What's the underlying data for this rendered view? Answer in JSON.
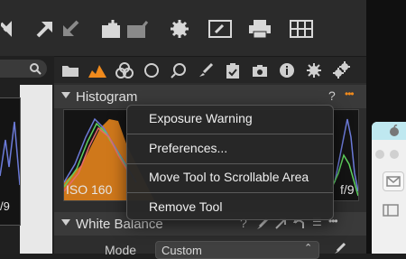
{
  "toolbar": {
    "icons": [
      "expand-arrow-icon",
      "arrow-up-right-icon",
      "arrow-down-left-icon",
      "add-collection-icon",
      "checkmark-collection-icon",
      "gear-icon",
      "edit-icon",
      "print-icon",
      "grid-icon"
    ]
  },
  "tool_tabs": [
    "folder-icon",
    "exposure-icon",
    "color-icon",
    "lens-icon",
    "search-icon",
    "brush-icon",
    "clipboard-icon",
    "camera-icon",
    "info-icon",
    "gear-icon",
    "batch-gear-icon"
  ],
  "histogram_panel": {
    "title": "Histogram",
    "help": "?",
    "more": "•••",
    "iso": "ISO 160",
    "aperture": "f/9",
    "side_aperture": "/9"
  },
  "white_balance_panel": {
    "title": "White Balance",
    "help": "?",
    "mode_label": "Mode",
    "mode_value": "Custom"
  },
  "context_menu": {
    "items": [
      "Exposure Warning",
      "Preferences...",
      "Move Tool to Scrollable Area",
      "Remove Tool"
    ]
  },
  "colors": {
    "accent": "#f08a1c",
    "background": "#1f1f1f",
    "panel_header": "#3a3a3a"
  }
}
